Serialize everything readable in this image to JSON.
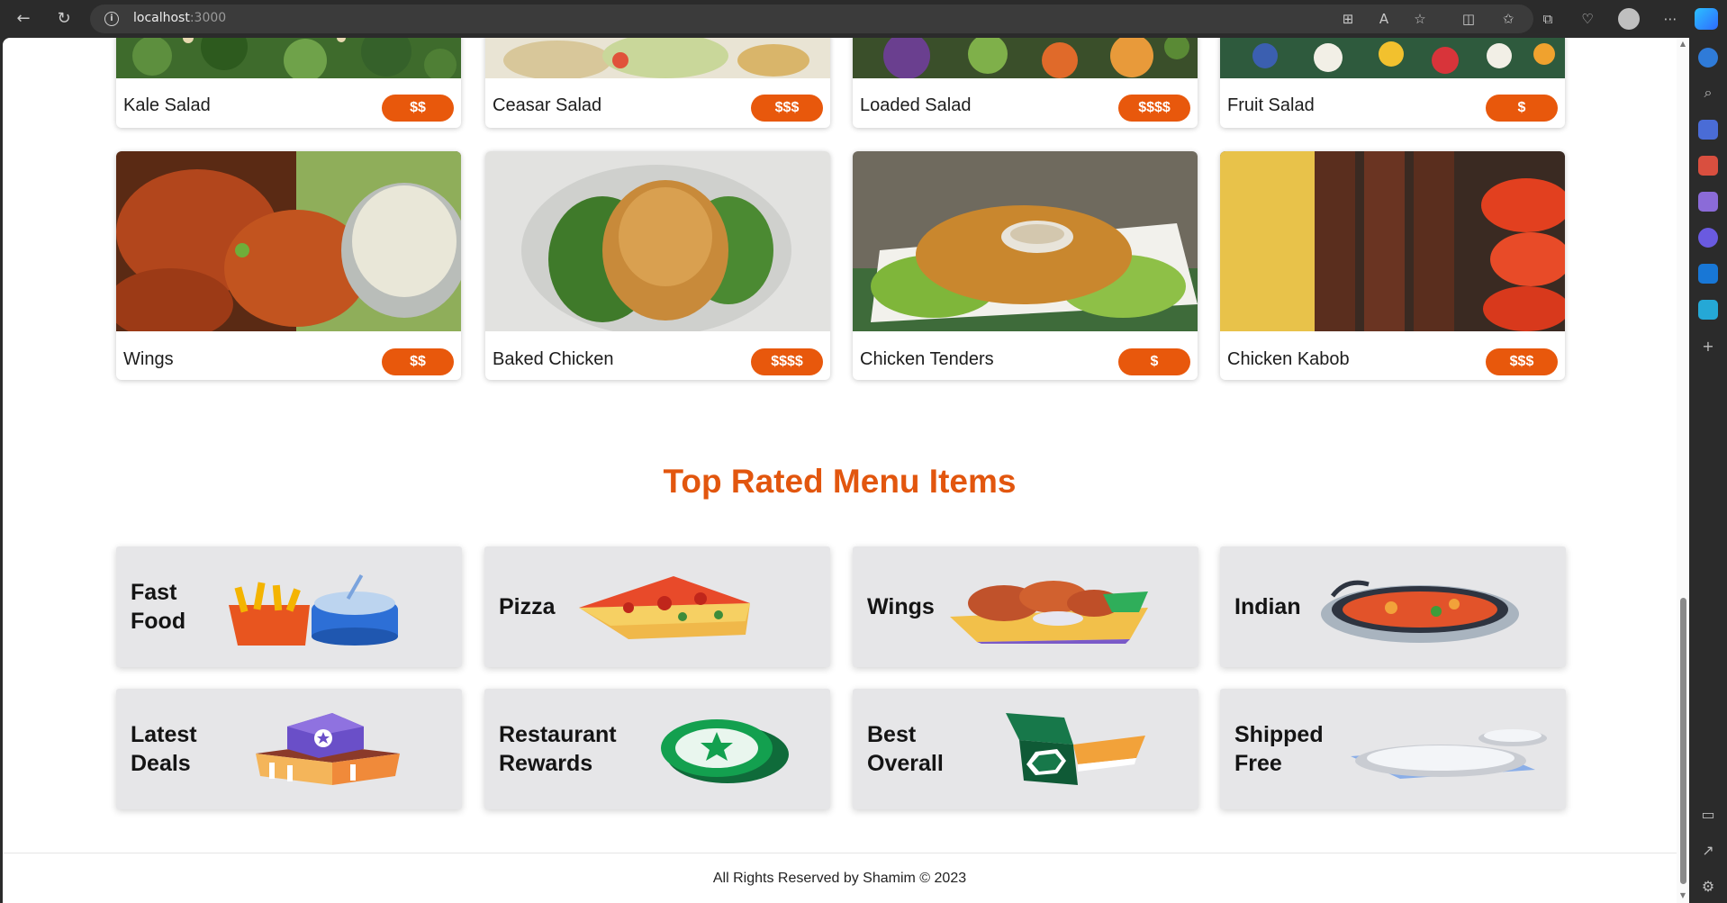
{
  "browser": {
    "url_host": "localhost",
    "url_port": ":3000"
  },
  "food_cards_top": [
    {
      "name": "Kale Salad",
      "price": "$$"
    },
    {
      "name": "Ceasar Salad",
      "price": "$$$"
    },
    {
      "name": "Loaded Salad",
      "price": "$$$$"
    },
    {
      "name": "Fruit Salad",
      "price": "$"
    }
  ],
  "food_cards": [
    {
      "name": "Wings",
      "price": "$$"
    },
    {
      "name": "Baked Chicken",
      "price": "$$$$"
    },
    {
      "name": "Chicken Tenders",
      "price": "$"
    },
    {
      "name": "Chicken Kabob",
      "price": "$$$"
    }
  ],
  "section": {
    "title": "Top Rated Menu Items"
  },
  "categories": [
    {
      "line1": "Fast",
      "line2": "Food"
    },
    {
      "line1": "Pizza",
      "line2": ""
    },
    {
      "line1": "Wings",
      "line2": ""
    },
    {
      "line1": "Indian",
      "line2": ""
    },
    {
      "line1": "Latest",
      "line2": "Deals"
    },
    {
      "line1": "Restaurant",
      "line2": "Rewards"
    },
    {
      "line1": "Best",
      "line2": "Overall"
    },
    {
      "line1": "Shipped",
      "line2": "Free"
    }
  ],
  "footer": {
    "text": "All Rights Reserved by Shamim © 2023"
  },
  "colors": {
    "accent": "#e8580c",
    "title": "#e2560e",
    "tile_bg": "#e6e6e8"
  }
}
